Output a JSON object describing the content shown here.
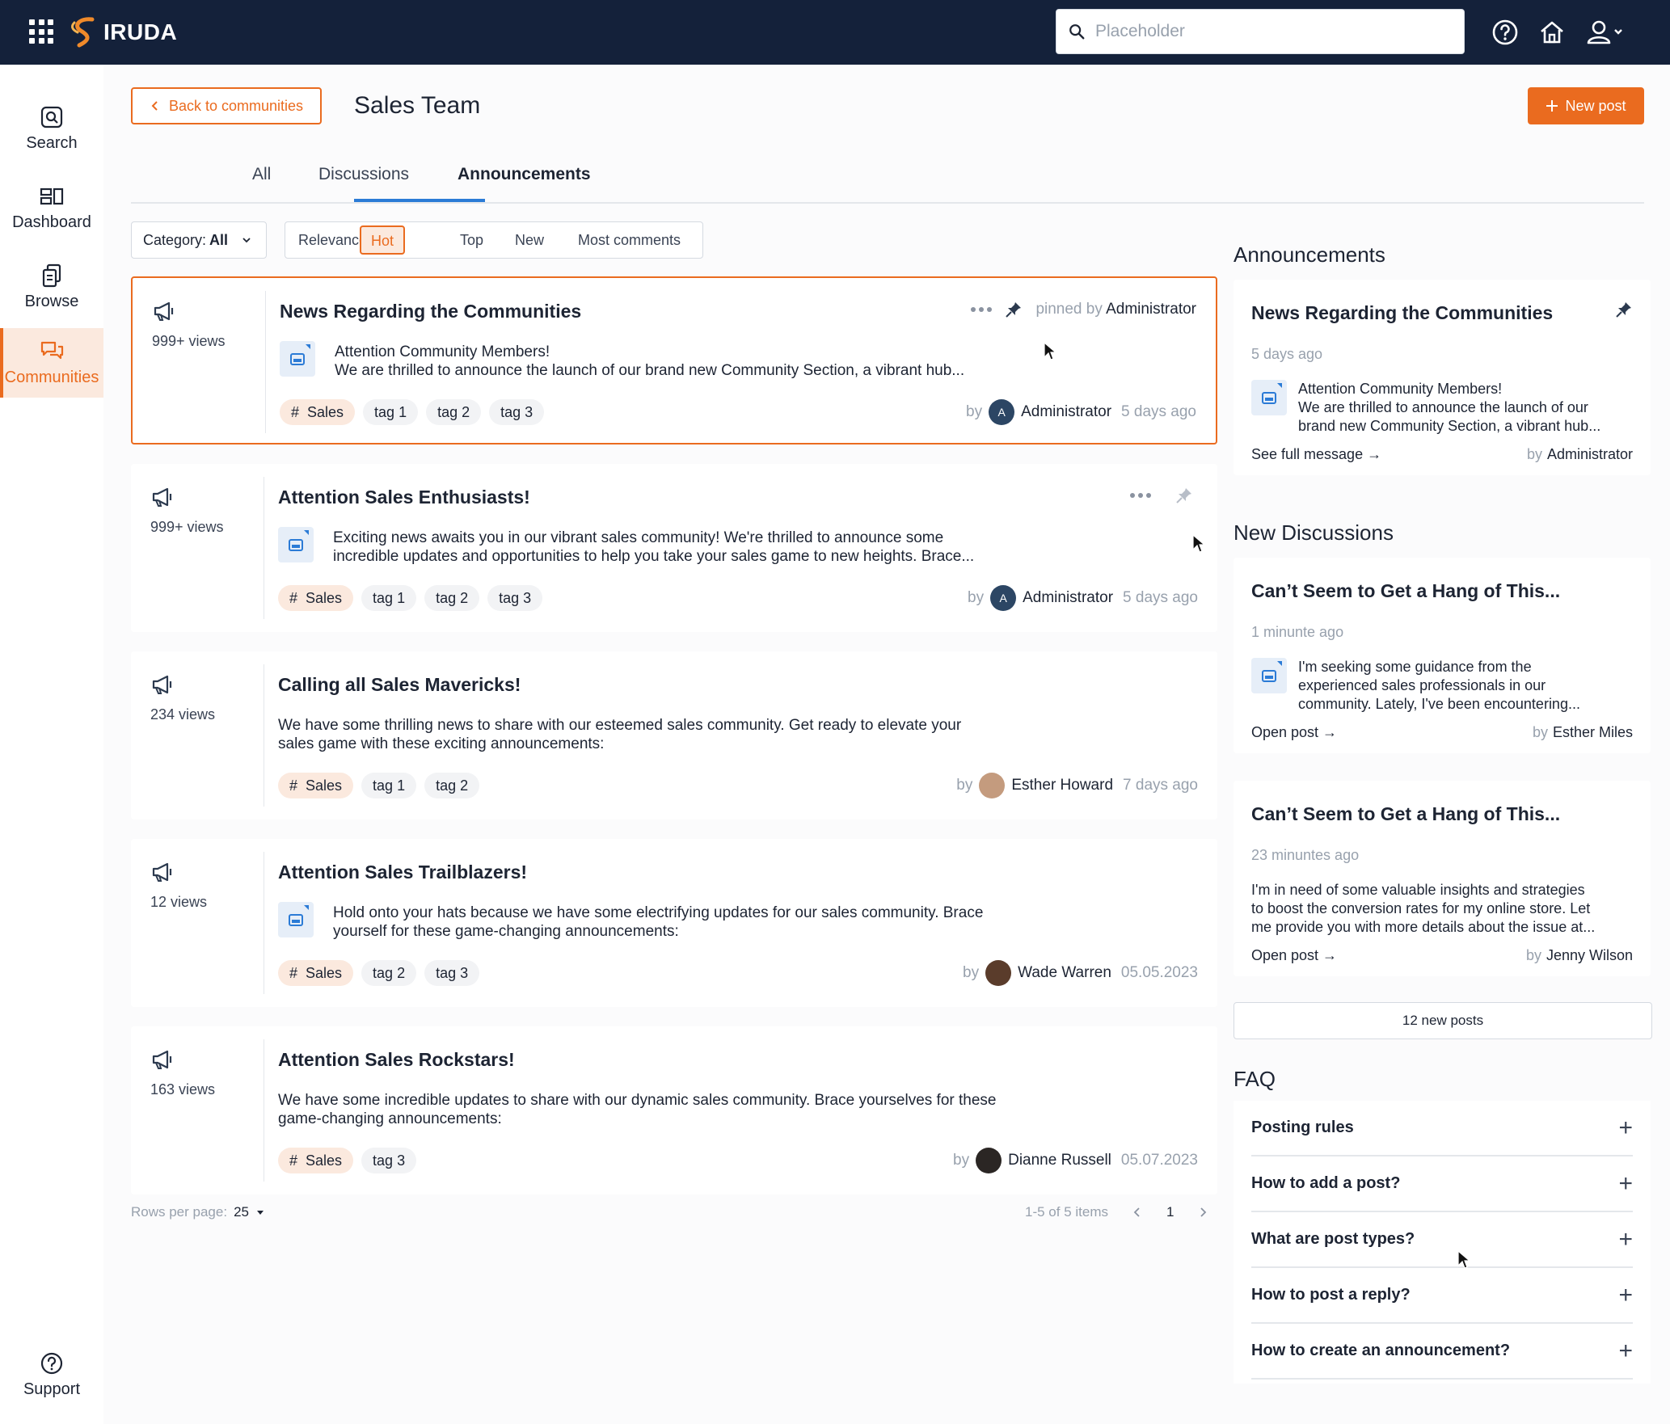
{
  "app": {
    "name": "IRUDA"
  },
  "topbar": {
    "search_placeholder": "Placeholder"
  },
  "leftnav": {
    "items": [
      {
        "label": "Search",
        "icon": "search-icon"
      },
      {
        "label": "Dashboard",
        "icon": "dashboard-icon"
      },
      {
        "label": "Browse",
        "icon": "browse-icon"
      },
      {
        "label": "Communities",
        "icon": "communities-icon",
        "active": true
      }
    ],
    "support_label": "Support"
  },
  "header": {
    "back_label": "Back to communities",
    "title": "Sales Team",
    "new_post_label": "New post"
  },
  "tabs": [
    {
      "label": "All"
    },
    {
      "label": "Discussions"
    },
    {
      "label": "Announcements",
      "active": true
    }
  ],
  "filters": {
    "category_prefix": "Category:",
    "category_value": "All",
    "sort_options": [
      "Relevance",
      "Hot",
      "Top",
      "New",
      "Most comments"
    ],
    "sort_selected": "Hot"
  },
  "posts": [
    {
      "views": "999+ views",
      "title": "News Regarding the Communities",
      "excerpt_line1": "Attention Community Members!",
      "excerpt_line2": "We are thrilled to announce the launch of our brand new Community Section, a vibrant hub...",
      "has_image": true,
      "pinned_prefix": "pinned by",
      "pinned_by": "Administrator",
      "tags": [
        "Sales",
        "tag 1",
        "tag 2",
        "tag 3"
      ],
      "by": "by",
      "author": "Administrator",
      "author_initial": "A",
      "time": "5 days ago"
    },
    {
      "views": "999+ views",
      "title": "Attention Sales Enthusiasts!",
      "excerpt_line1": "Exciting news awaits you in our vibrant sales community! We're thrilled to announce some",
      "excerpt_line2": "incredible updates and opportunities to help you take your sales game to new heights. Brace...",
      "has_image": true,
      "tags": [
        "Sales",
        "tag 1",
        "tag 2",
        "tag 3"
      ],
      "by": "by",
      "author": "Administrator",
      "author_initial": "A",
      "time": "5 days ago"
    },
    {
      "views": "234 views",
      "title": "Calling all Sales Mavericks!",
      "excerpt_line1": "We have some thrilling news to share with our esteemed sales community. Get ready to elevate your",
      "excerpt_line2": "sales game with these exciting announcements:",
      "has_image": false,
      "tags": [
        "Sales",
        "tag 1",
        "tag 2"
      ],
      "by": "by",
      "author": "Esther Howard",
      "time": "7 days ago"
    },
    {
      "views": "12 views",
      "title": "Attention Sales Trailblazers!",
      "excerpt_line1": "Hold onto your hats because we have some electrifying updates for our sales community. Brace",
      "excerpt_line2": "yourself for these game-changing announcements:",
      "has_image": true,
      "tags": [
        "Sales",
        "tag 2",
        "tag 3"
      ],
      "by": "by",
      "author": "Wade Warren",
      "time": "05.05.2023"
    },
    {
      "views": "163 views",
      "title": "Attention Sales Rockstars!",
      "excerpt_line1": "We have some incredible updates to share with our dynamic sales community. Brace yourselves for these",
      "excerpt_line2": "game-changing announcements:",
      "has_image": false,
      "tags": [
        "Sales",
        "tag 3"
      ],
      "by": "by",
      "author": "Dianne Russell",
      "time": "05.07.2023"
    }
  ],
  "pagination": {
    "rows_label": "Rows per page:",
    "rows_value": "25",
    "range": "1-5 of 5 items",
    "page": "1"
  },
  "right": {
    "announcements_title": "Announcements",
    "announcement": {
      "title": "News Regarding the Communities",
      "time": "5 days ago",
      "line1": "Attention Community Members!",
      "line2": "We are thrilled to announce the launch of our",
      "line3": "brand new Community Section, a vibrant hub...",
      "link": "See full message →",
      "by": "by",
      "author": "Administrator"
    },
    "discussions_title": "New Discussions",
    "discussions": [
      {
        "title": "Can’t Seem to Get a Hang of This...",
        "time": "1 minunte ago",
        "line1": "I'm seeking some guidance from the",
        "line2": "experienced sales professionals in our",
        "line3": "community. Lately, I've been encountering...",
        "link": "Open post →",
        "by": "by",
        "author": "Esther Miles"
      },
      {
        "title": "Can’t Seem to Get a Hang of This...",
        "time": "23 minuntes ago",
        "line1": "I'm in need of some valuable insights and strategies",
        "line2": "to boost the conversion rates for my online store. Let",
        "line3": "me provide you with more details about the issue at...",
        "link": "Open post →",
        "by": "by",
        "author": "Jenny Wilson"
      }
    ],
    "new_posts_label": "12 new posts",
    "faq_title": "FAQ",
    "faq": [
      "Posting rules",
      "How to add a post?",
      "What are post types?",
      "How to post a reply?",
      "How to create an announcement?"
    ]
  },
  "colors": {
    "accent": "#ea6b1f",
    "topbar": "#14213a",
    "tab_underline": "#2b7bd6"
  }
}
